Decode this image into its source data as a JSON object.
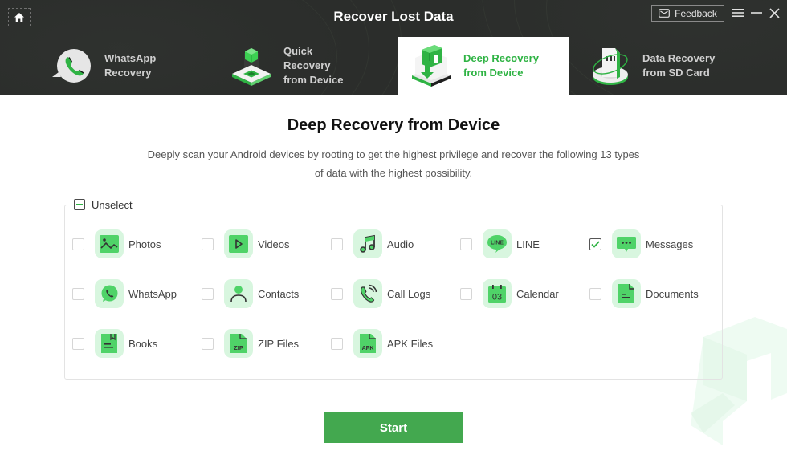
{
  "header": {
    "title": "Recover Lost Data",
    "feedback_label": "Feedback",
    "home_icon": "home-icon",
    "window_controls": [
      "menu-icon",
      "minimize-icon",
      "close-icon"
    ]
  },
  "tabs": [
    {
      "label": "WhatsApp\nRecovery",
      "icon": "whatsapp-recovery-icon",
      "active": false
    },
    {
      "label": "Quick Recovery\nfrom Device",
      "icon": "quick-recovery-icon",
      "active": false
    },
    {
      "label": "Deep Recovery\nfrom Device",
      "icon": "deep-recovery-icon",
      "active": true
    },
    {
      "label": "Data Recovery\nfrom SD Card",
      "icon": "sd-card-recovery-icon",
      "active": false
    }
  ],
  "main": {
    "title": "Deep Recovery from Device",
    "description": "Deeply scan your Android devices by rooting to get the highest privilege and recover the following 13 types of data with the highest possibility.",
    "unselect_label": "Unselect",
    "items": [
      {
        "label": "Photos",
        "icon": "photo-icon",
        "checked": false
      },
      {
        "label": "Videos",
        "icon": "video-icon",
        "checked": false
      },
      {
        "label": "Audio",
        "icon": "music-icon",
        "checked": false
      },
      {
        "label": "LINE",
        "icon": "line-icon",
        "checked": false
      },
      {
        "label": "Messages",
        "icon": "message-icon",
        "checked": true
      },
      {
        "label": "WhatsApp",
        "icon": "whatsapp-icon",
        "checked": false
      },
      {
        "label": "Contacts",
        "icon": "contact-icon",
        "checked": false
      },
      {
        "label": "Call Logs",
        "icon": "call-log-icon",
        "checked": false
      },
      {
        "label": "Calendar",
        "icon": "calendar-icon",
        "checked": false
      },
      {
        "label": "Documents",
        "icon": "document-icon",
        "checked": false
      },
      {
        "label": "Books",
        "icon": "book-icon",
        "checked": false
      },
      {
        "label": "ZIP Files",
        "icon": "zip-icon",
        "checked": false
      },
      {
        "label": "APK Files",
        "icon": "apk-icon",
        "checked": false
      }
    ],
    "icon_text": {
      "line": "LINE",
      "calendar": "03",
      "zip": "ZIP",
      "apk": "APK"
    },
    "start_label": "Start"
  },
  "colors": {
    "accent": "#2fb344",
    "button": "#43a84f",
    "header_bg": "#2b2d2b",
    "icon_bg": "#d8f6df"
  }
}
